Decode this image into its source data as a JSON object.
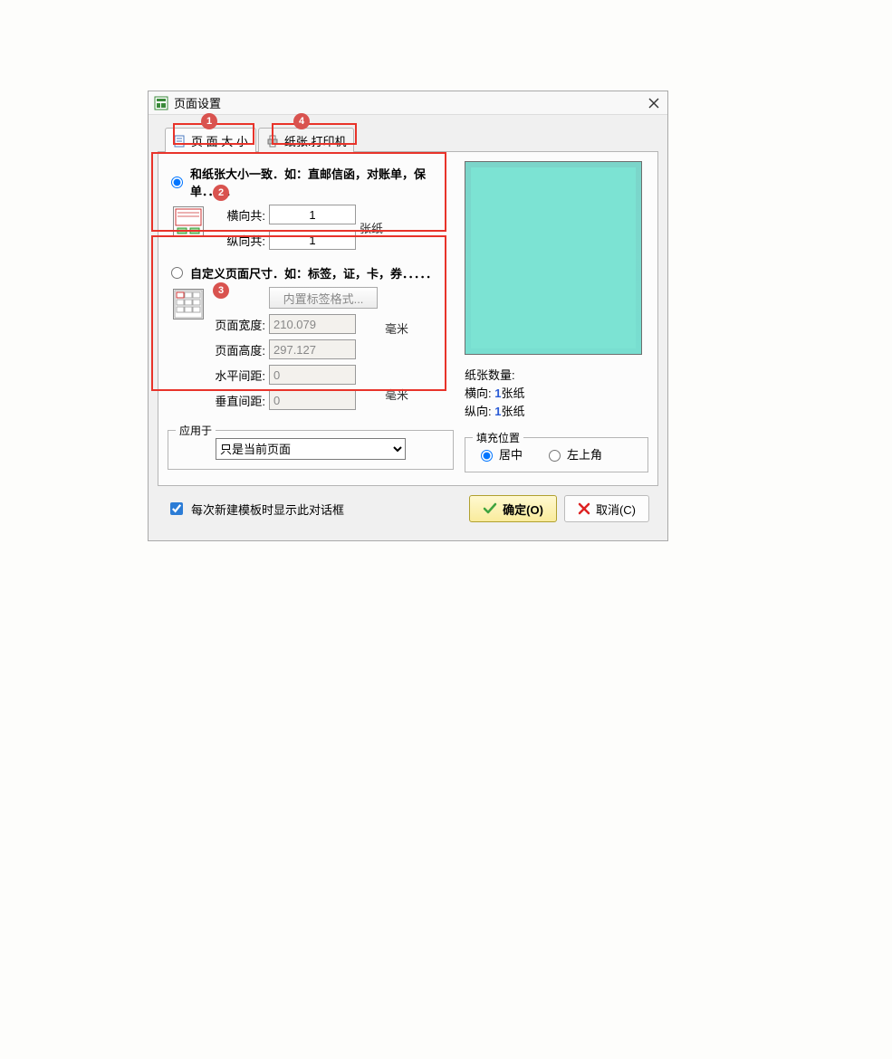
{
  "window": {
    "title": "页面设置"
  },
  "tabs": {
    "page_size": "页 面 大 小",
    "paper_printer": "纸张.打印机"
  },
  "markers": {
    "one": "1",
    "two": "2",
    "three": "3",
    "four": "4"
  },
  "option_paper": {
    "label": "和纸张大小一致．如：直邮信函，对账单，保单．．．．．",
    "hcount_label": "横向共:",
    "hcount_value": "1",
    "vcount_label": "纵向共:",
    "vcount_value": "1",
    "unit": "张纸"
  },
  "option_custom": {
    "label": "自定义页面尺寸．如：标签，证，卡，券．．．．．",
    "builtin_btn": "内置标签格式...",
    "width_label": "页面宽度:",
    "width_value": "210.079",
    "height_label": "页面高度:",
    "height_value": "297.127",
    "hgap_label": "水平间距:",
    "hgap_value": "0",
    "vgap_label": "垂直间距:",
    "vgap_value": "0",
    "unit": "毫米"
  },
  "apply": {
    "legend": "应用于",
    "value": "只是当前页面"
  },
  "preview": {
    "count_label": "纸张数量:",
    "hor_prefix": "横向: ",
    "hor_num": "1",
    "hor_suffix": "张纸",
    "ver_prefix": "纵向: ",
    "ver_num": "1",
    "ver_suffix": "张纸"
  },
  "fill": {
    "legend": "填充位置",
    "center": "居中",
    "topleft": "左上角"
  },
  "footer": {
    "checkbox": "每次新建模板时显示此对话框",
    "ok": "确定(O)",
    "cancel": "取消(C)"
  }
}
